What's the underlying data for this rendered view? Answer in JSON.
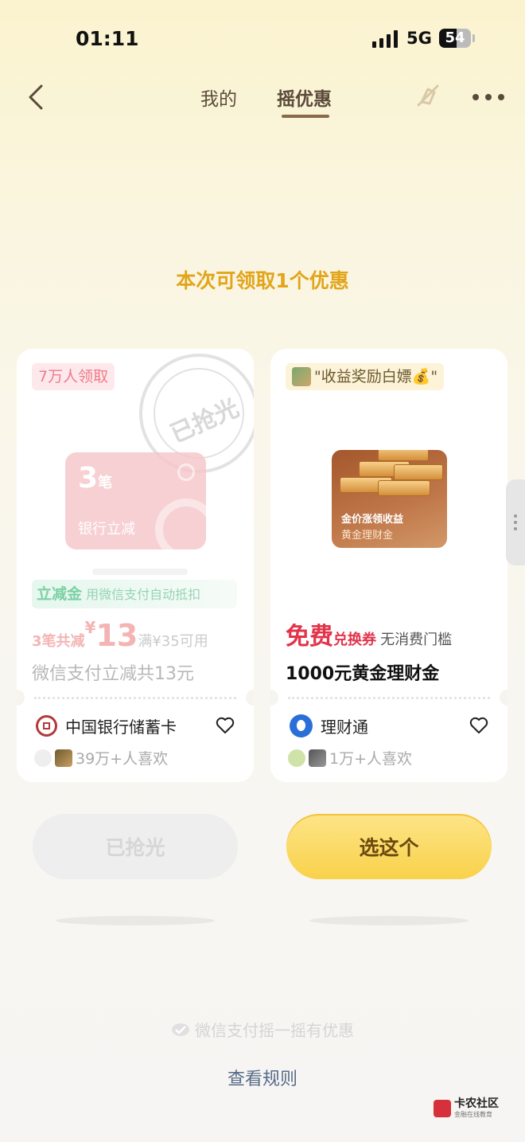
{
  "status": {
    "time": "01:11",
    "network": "5G",
    "battery": "54",
    "battery_level": 0.54
  },
  "nav": {
    "tab_mine": "我的",
    "tab_shake": "摇优惠",
    "active_tab": "摇优惠"
  },
  "headline": "本次可领取1个优惠",
  "cards": [
    {
      "tag": "7万人领取",
      "stamp": "已抢光",
      "card_count": "3",
      "card_count_unit": "笔",
      "card_label": "银行立减",
      "strip_title": "立减金",
      "strip_text": "用微信支付自动抵扣",
      "price_prefix": "3笔共减",
      "currency": "¥",
      "price_value": "13",
      "condition": "满¥35可用",
      "description": "微信支付立减共13元",
      "brand": "中国银行储蓄卡",
      "likes": "39万+人喜欢",
      "button": "已抢光"
    },
    {
      "tag": "\"收益奖励白嫖💰\"",
      "gold_title": "金价涨领收益",
      "gold_subtitle": "黄金理财金",
      "free_label": "免费",
      "coupon_type": "兑换券",
      "threshold": "无消费门槛",
      "description": "1000元黄金理财金",
      "brand": "理财通",
      "likes": "1万+人喜欢",
      "button": "选这个"
    }
  ],
  "footer": {
    "slogan": "微信支付摇一摇有优惠",
    "rules": "查看规则"
  },
  "watermark": {
    "name": "卡农社区",
    "tagline": "金融在线教育"
  },
  "colors": {
    "headline": "#e2a51a",
    "accent_red": "#e2334a",
    "button_yellow": "#f9d24a",
    "rules_link": "#566b8a"
  },
  "icons": [
    "back-icon",
    "mute-icon",
    "more-icon",
    "heart-icon",
    "wechat-pay-icon"
  ]
}
